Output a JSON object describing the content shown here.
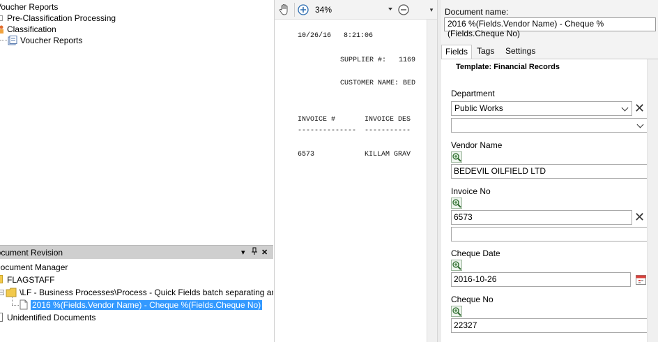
{
  "left_tree": {
    "voucher_reports_root": "Voucher Reports",
    "pre_classification": "Pre-Classification Processing",
    "classification": "Classification",
    "voucher_reports_child": "Voucher Reports"
  },
  "panel": {
    "title": "Document Revision",
    "pin_symbol": "▾ ╤ ✕"
  },
  "doc_tree": {
    "root": "Document Manager",
    "repo": "FLAGSTAFF",
    "folder": "\\LF - Business Processes\\Process - Quick Fields batch separating and",
    "document": "2016 %(Fields.Vendor Name) - Cheque %(Fields.Cheque No)",
    "unidentified": "Unidentified Documents"
  },
  "viewer": {
    "zoom": "34%",
    "lines": [
      "10/26/16   8:21:06",
      "SUPPLIER #:   1169",
      "CUSTOMER NAME: BED",
      "INVOICE #       INVOICE DES",
      "--------------  -----------",
      "6573            KILLAM GRAV"
    ]
  },
  "metadata": {
    "doc_name_label": "Document name:",
    "doc_name_value": "2016 %(Fields.Vendor Name) - Cheque %(Fields.Cheque No)",
    "tabs": [
      "Fields",
      "Tags",
      "Settings"
    ],
    "template": "Template: Financial Records",
    "fields": {
      "department_label": "Department",
      "department_value": "Public Works",
      "department_value2": "",
      "vendor_label": "Vendor Name",
      "vendor_value": "BEDEVIL OILFIELD LTD",
      "invoice_label": "Invoice No",
      "invoice_value": "6573",
      "invoice_value2": "",
      "cheque_date_label": "Cheque Date",
      "cheque_date_value": "2016-10-26",
      "cheque_no_label": "Cheque No",
      "cheque_no_value": "22327"
    }
  },
  "colors": {
    "selection": "#3399ff",
    "folder": "#f2c94c",
    "calendar_red": "#d9413b",
    "zoom_blue": "#2b6cb0"
  }
}
